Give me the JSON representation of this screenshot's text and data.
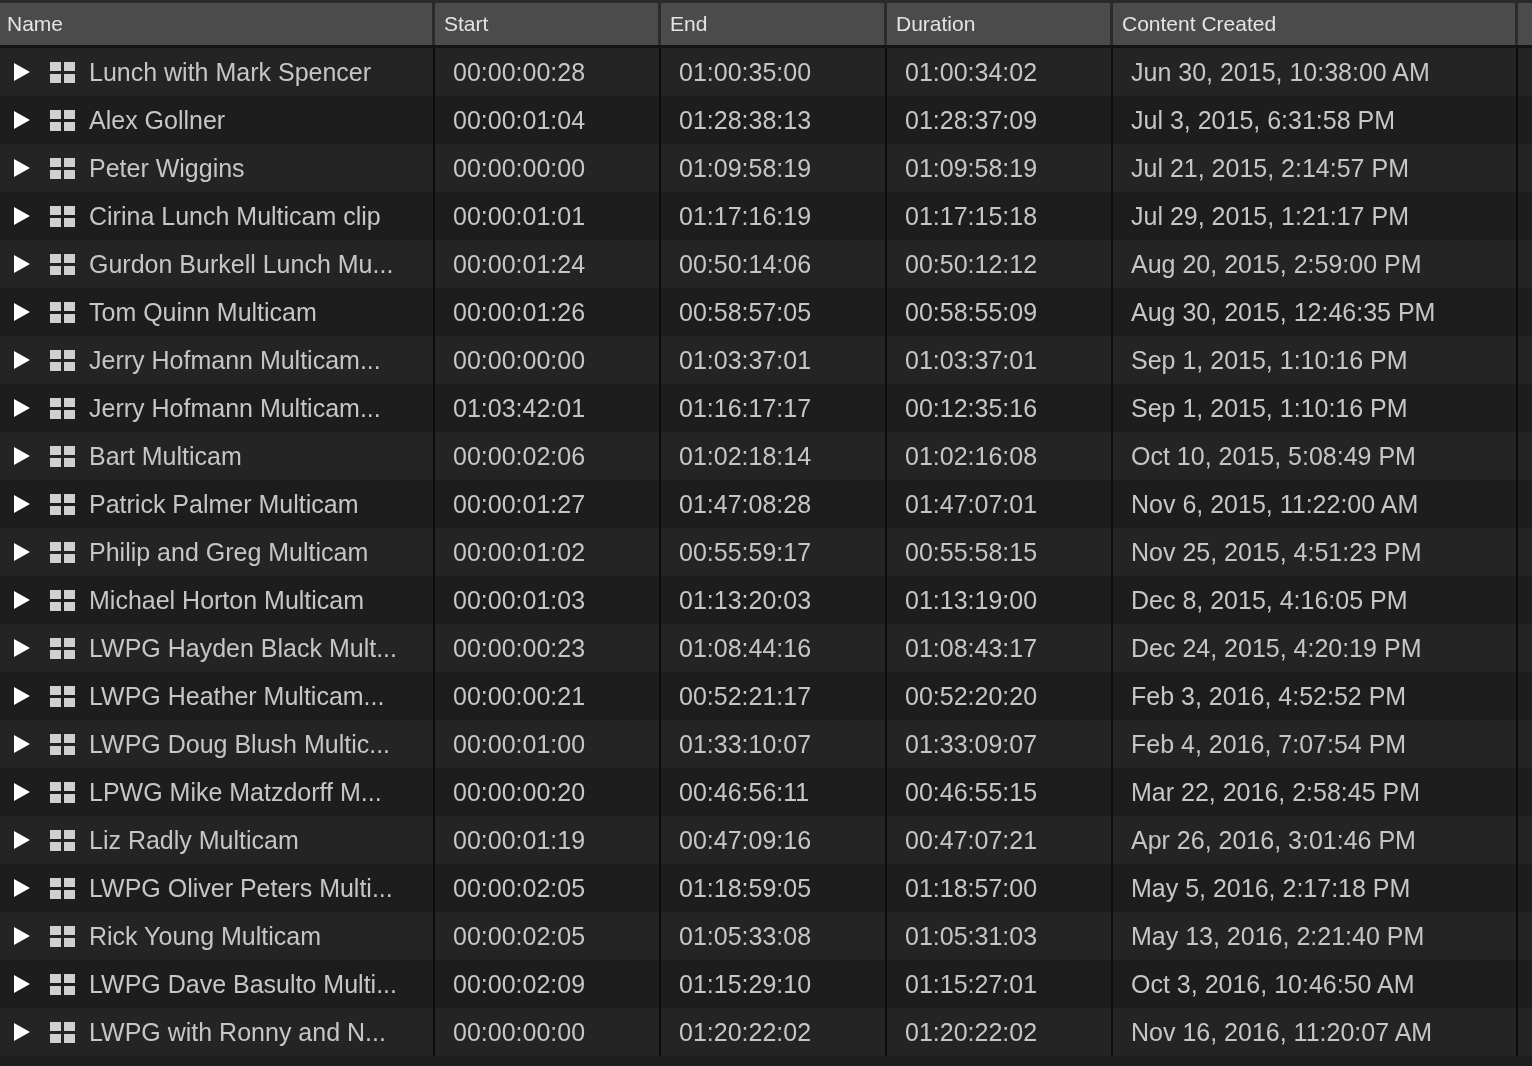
{
  "table": {
    "columns": [
      "Name",
      "Start",
      "End",
      "Duration",
      "Content Created"
    ],
    "rows": [
      {
        "expanded": false,
        "cells": [
          "Lunch with Mark Spencer",
          "00:00:00:28",
          "01:00:35:00",
          "01:00:34:02",
          "Jun 30, 2015, 10:38:00 AM"
        ]
      },
      {
        "expanded": false,
        "cells": [
          "Alex Gollner",
          "00:00:01:04",
          "01:28:38:13",
          "01:28:37:09",
          "Jul 3, 2015, 6:31:58 PM"
        ]
      },
      {
        "expanded": false,
        "cells": [
          "Peter Wiggins",
          "00:00:00:00",
          "01:09:58:19",
          "01:09:58:19",
          "Jul 21, 2015, 2:14:57 PM"
        ]
      },
      {
        "expanded": false,
        "cells": [
          "Cirina Lunch Multicam clip",
          "00:00:01:01",
          "01:17:16:19",
          "01:17:15:18",
          "Jul 29, 2015, 1:21:17 PM"
        ]
      },
      {
        "expanded": false,
        "cells": [
          "Gurdon Burkell Lunch Mu...",
          "00:00:01:24",
          "00:50:14:06",
          "00:50:12:12",
          "Aug 20, 2015, 2:59:00 PM"
        ]
      },
      {
        "expanded": false,
        "cells": [
          "Tom Quinn Multicam",
          "00:00:01:26",
          "00:58:57:05",
          "00:58:55:09",
          "Aug 30, 2015, 12:46:35 PM"
        ]
      },
      {
        "expanded": false,
        "cells": [
          "Jerry Hofmann Multicam...",
          "00:00:00:00",
          "01:03:37:01",
          "01:03:37:01",
          "Sep 1, 2015, 1:10:16 PM"
        ]
      },
      {
        "expanded": false,
        "cells": [
          "Jerry Hofmann Multicam...",
          "01:03:42:01",
          "01:16:17:17",
          "00:12:35:16",
          "Sep 1, 2015, 1:10:16 PM"
        ]
      },
      {
        "expanded": false,
        "cells": [
          "Bart Multicam",
          "00:00:02:06",
          "01:02:18:14",
          "01:02:16:08",
          "Oct 10, 2015, 5:08:49 PM"
        ]
      },
      {
        "expanded": false,
        "cells": [
          "Patrick Palmer Multicam",
          "00:00:01:27",
          "01:47:08:28",
          "01:47:07:01",
          "Nov 6, 2015, 11:22:00 AM"
        ]
      },
      {
        "expanded": false,
        "cells": [
          "Philip and Greg Multicam",
          "00:00:01:02",
          "00:55:59:17",
          "00:55:58:15",
          "Nov 25, 2015, 4:51:23 PM"
        ]
      },
      {
        "expanded": false,
        "cells": [
          "Michael Horton Multicam",
          "00:00:01:03",
          "01:13:20:03",
          "01:13:19:00",
          "Dec 8, 2015, 4:16:05 PM"
        ]
      },
      {
        "expanded": false,
        "cells": [
          "LWPG Hayden Black Mult...",
          "00:00:00:23",
          "01:08:44:16",
          "01:08:43:17",
          "Dec 24, 2015, 4:20:19 PM"
        ]
      },
      {
        "expanded": false,
        "cells": [
          "LWPG Heather Multicam...",
          "00:00:00:21",
          "00:52:21:17",
          "00:52:20:20",
          "Feb 3, 2016, 4:52:52 PM"
        ]
      },
      {
        "expanded": false,
        "cells": [
          "LWPG Doug Blush Multic...",
          "00:00:01:00",
          "01:33:10:07",
          "01:33:09:07",
          "Feb 4, 2016, 7:07:54 PM"
        ]
      },
      {
        "expanded": false,
        "cells": [
          "LPWG Mike Matzdorff M...",
          "00:00:00:20",
          "00:46:56:11",
          "00:46:55:15",
          "Mar 22, 2016, 2:58:45 PM"
        ]
      },
      {
        "expanded": false,
        "cells": [
          "Liz Radly Multicam",
          "00:00:01:19",
          "00:47:09:16",
          "00:47:07:21",
          "Apr 26, 2016, 3:01:46 PM"
        ]
      },
      {
        "expanded": false,
        "cells": [
          "LWPG Oliver Peters Multi...",
          "00:00:02:05",
          "01:18:59:05",
          "01:18:57:00",
          "May 5, 2016, 2:17:18 PM"
        ]
      },
      {
        "expanded": false,
        "cells": [
          "Rick Young Multicam",
          "00:00:02:05",
          "01:05:33:08",
          "01:05:31:03",
          "May 13, 2016, 2:21:40 PM"
        ]
      },
      {
        "expanded": false,
        "cells": [
          "LWPG Dave Basulto Multi...",
          "00:00:02:09",
          "01:15:29:10",
          "01:15:27:01",
          "Oct 3, 2016, 10:46:50 AM"
        ]
      },
      {
        "expanded": false,
        "cells": [
          "LWPG with Ronny and N...",
          "00:00:00:00",
          "01:20:22:02",
          "01:20:22:02",
          "Nov 16, 2016, 11:20:07 AM"
        ]
      }
    ]
  }
}
